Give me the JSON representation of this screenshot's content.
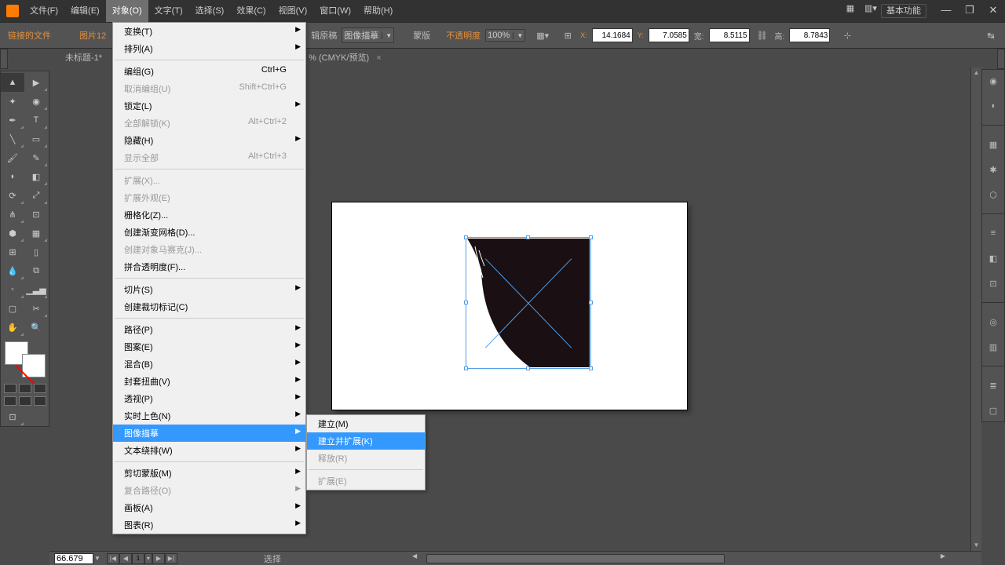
{
  "menubar": {
    "items": [
      "文件(F)",
      "编辑(E)",
      "对象(O)",
      "文字(T)",
      "选择(S)",
      "效果(C)",
      "视图(V)",
      "窗口(W)",
      "帮助(H)"
    ],
    "active_index": 2,
    "workspace": "基本功能"
  },
  "controlbar": {
    "linked_file": "链接的文件",
    "image_label": "图片12",
    "edit_original": "辑原稿",
    "image_trace": "图像描摹",
    "mask": "蒙版",
    "opacity_label": "不透明度",
    "opacity_value": "100%",
    "x_label": "X:",
    "x_value": "14.1684",
    "y_label": "Y:",
    "y_value": "7.0585",
    "w_label": "宽:",
    "w_value": "8.5115",
    "h_label": "高:",
    "h_value": "8.7843"
  },
  "tab": {
    "name": "未标题-1*",
    "details": "% (CMYK/预览)"
  },
  "statusbar": {
    "zoom": "66.679",
    "page": "1",
    "status": "选择"
  },
  "object_menu": [
    {
      "label": "变换(T)",
      "sub": true
    },
    {
      "label": "排列(A)",
      "sub": true
    },
    {
      "sep": true
    },
    {
      "label": "编组(G)",
      "shortcut": "Ctrl+G"
    },
    {
      "label": "取消编组(U)",
      "shortcut": "Shift+Ctrl+G",
      "disabled": true
    },
    {
      "label": "锁定(L)",
      "sub": true
    },
    {
      "label": "全部解锁(K)",
      "shortcut": "Alt+Ctrl+2",
      "disabled": true
    },
    {
      "label": "隐藏(H)",
      "sub": true
    },
    {
      "label": "显示全部",
      "shortcut": "Alt+Ctrl+3",
      "disabled": true
    },
    {
      "sep": true
    },
    {
      "label": "扩展(X)...",
      "disabled": true
    },
    {
      "label": "扩展外观(E)",
      "disabled": true
    },
    {
      "label": "栅格化(Z)..."
    },
    {
      "label": "创建渐变网格(D)..."
    },
    {
      "label": "创建对象马赛克(J)...",
      "disabled": true
    },
    {
      "label": "拼合透明度(F)..."
    },
    {
      "sep": true
    },
    {
      "label": "切片(S)",
      "sub": true
    },
    {
      "label": "创建裁切标记(C)"
    },
    {
      "sep": true
    },
    {
      "label": "路径(P)",
      "sub": true
    },
    {
      "label": "图案(E)",
      "sub": true
    },
    {
      "label": "混合(B)",
      "sub": true
    },
    {
      "label": "封套扭曲(V)",
      "sub": true
    },
    {
      "label": "透视(P)",
      "sub": true
    },
    {
      "label": "实时上色(N)",
      "sub": true
    },
    {
      "label": "图像描摹",
      "sub": true,
      "hover": true
    },
    {
      "label": "文本绕排(W)",
      "sub": true
    },
    {
      "sep": true
    },
    {
      "label": "剪切蒙版(M)",
      "sub": true
    },
    {
      "label": "复合路径(O)",
      "sub": true,
      "disabled": true
    },
    {
      "label": "画板(A)",
      "sub": true
    },
    {
      "label": "图表(R)",
      "sub": true
    }
  ],
  "trace_submenu": [
    {
      "label": "建立(M)"
    },
    {
      "label": "建立并扩展(K)",
      "hover": true
    },
    {
      "label": "释放(R)",
      "disabled": true
    },
    {
      "sep": true
    },
    {
      "label": "扩展(E)",
      "disabled": true
    }
  ]
}
